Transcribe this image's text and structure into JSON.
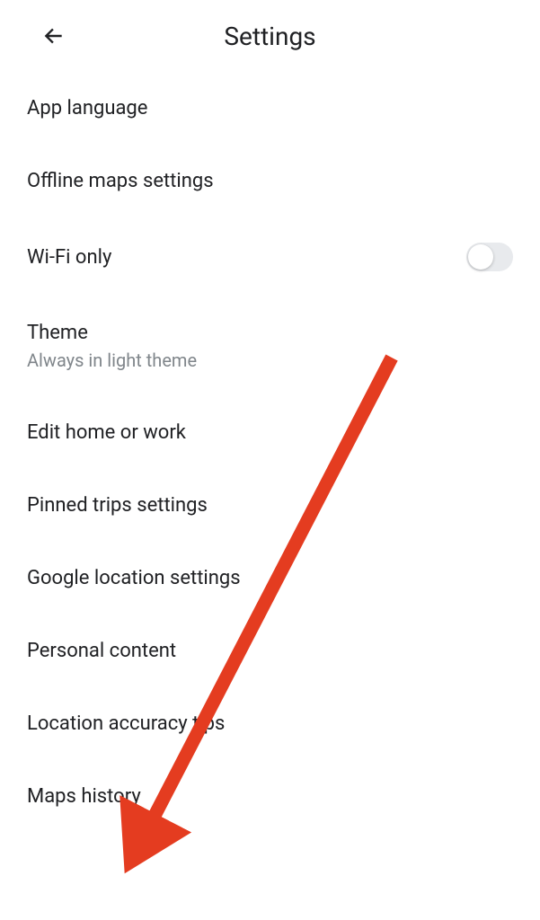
{
  "header": {
    "title": "Settings"
  },
  "settings": {
    "app_language": {
      "label": "App language"
    },
    "offline_maps": {
      "label": "Offline maps settings"
    },
    "wifi_only": {
      "label": "Wi-Fi only",
      "toggle_state": "off"
    },
    "theme": {
      "label": "Theme",
      "sublabel": "Always in light theme"
    },
    "edit_home_work": {
      "label": "Edit home or work"
    },
    "pinned_trips": {
      "label": "Pinned trips settings"
    },
    "google_location": {
      "label": "Google location settings"
    },
    "personal_content": {
      "label": "Personal content"
    },
    "location_accuracy": {
      "label": "Location accuracy tips"
    },
    "maps_history": {
      "label": "Maps history"
    }
  },
  "annotation": {
    "arrow_color": "#e43c20"
  }
}
